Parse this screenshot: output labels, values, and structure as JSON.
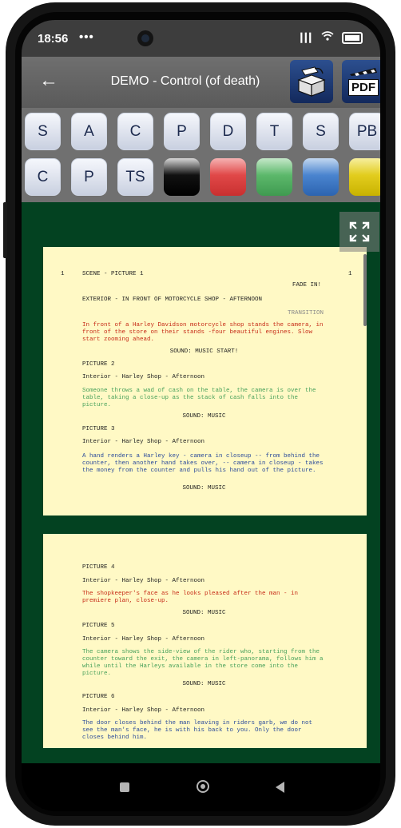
{
  "status": {
    "time": "18:56",
    "extra": "•••",
    "icons": "▎▎▎"
  },
  "appbar": {
    "back": "←",
    "title": "DEMO - Control (of death)",
    "pdf_label": "PDF"
  },
  "toolbar": {
    "row1": [
      "S",
      "A",
      "C",
      "P",
      "D",
      "T",
      "S",
      "PB"
    ],
    "row2": [
      "C",
      "P",
      "TS"
    ],
    "swatch_colors": [
      "#111111",
      "#e04848",
      "#5cb86b",
      "#4a84cf",
      "#e2cd1e"
    ]
  },
  "page1": {
    "scene_num_left": "1",
    "scene_heading": "SCENE - PICTURE 1",
    "scene_num_right": "1",
    "fade_in": "FADE IN!",
    "exterior": "EXTERIOR - IN FRONT OF MOTORCYCLE SHOP - AFTERNOON",
    "transition": "TRANSITION",
    "action1": "In front of a Harley Davidson motorcycle shop stands the camera, in front of the store on their stands -four beautiful engines. Slow start zooming ahead.",
    "sound1": "SOUND: MUSIC START!",
    "pic2": "PICTURE 2",
    "int2": "Interior - Harley Shop - Afternoon",
    "action2": "Someone throws a wad of cash on the table, the camera is over the table, taking a close-up as the stack of cash falls into the picture.",
    "sound2": "SOUND: MUSIC",
    "pic3": "PICTURE 3",
    "int3": "Interior - Harley Shop - Afternoon",
    "action3": "A hand renders a Harley key - camera in closeup -- from behind the counter, then another hand takes over, -- camera in closeup - takes the money from the counter and pulls his hand out of the picture.",
    "sound3": "SOUND: MUSIC"
  },
  "page2": {
    "pic4": "PICTURE 4",
    "int4": "Interior - Harley Shop - Afternoon",
    "action4": "The shopkeeper's face as he looks pleased after the man - in premiere plan, close-up.",
    "sound4": "SOUND: MUSIC",
    "pic5": "PICTURE 5",
    "int5": "Interior - Harley Shop - Afternoon",
    "action5": "The camera shows the side-view of the rider who, starting from the counter toward the exit, the camera in left-panorama, follows him a while until the Harleys available in the store come into the picture.",
    "sound5": "SOUND: MUSIC",
    "pic6": "PICTURE 6",
    "int6": "Interior - Harley Shop - Afternoon",
    "action6": "The door closes behind the man leaving in riders garb, we do not see the man's face, he is with his back to you. Only the door closes behind him."
  }
}
